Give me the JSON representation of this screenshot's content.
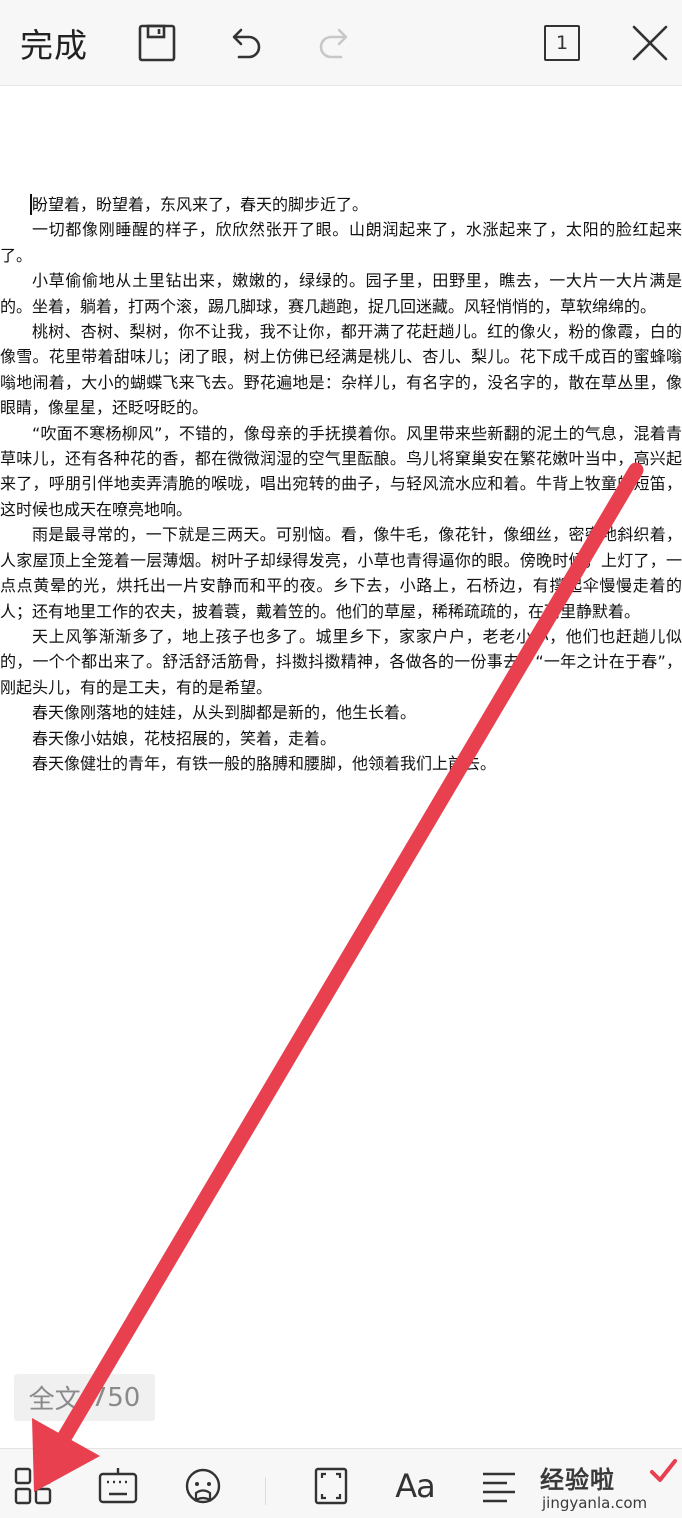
{
  "toolbar": {
    "done_label": "完成",
    "page_count": "1",
    "icons": [
      "save-icon",
      "undo-icon",
      "redo-icon",
      "page-count-icon",
      "close-icon"
    ]
  },
  "document": {
    "paragraphs": [
      "盼望着，盼望着，东风来了，春天的脚步近了。",
      "一切都像刚睡醒的样子，欣欣然张开了眼。山朗润起来了，水涨起来了，太阳的脸红起来了。",
      "小草偷偷地从土里钻出来，嫩嫩的，绿绿的。园子里，田野里，瞧去，一大片一大片满是的。坐着，躺着，打两个滚，踢几脚球，赛几趟跑，捉几回迷藏。风轻悄悄的，草软绵绵的。",
      "桃树、杏树、梨树，你不让我，我不让你，都开满了花赶趟儿。红的像火，粉的像霞，白的像雪。花里带着甜味儿；闭了眼，树上仿佛已经满是桃儿、杏儿、梨儿。花下成千成百的蜜蜂嗡嗡地闹着，大小的蝴蝶飞来飞去。野花遍地是：杂样儿，有名字的，没名字的，散在草丛里，像眼睛，像星星，还眨呀眨的。",
      "“吹面不寒杨柳风”，不错的，像母亲的手抚摸着你。风里带来些新翻的泥土的气息，混着青草味儿，还有各种花的香，都在微微润湿的空气里酝酿。鸟儿将窠巢安在繁花嫩叶当中，高兴起来了，呼朋引伴地卖弄清脆的喉咙，唱出宛转的曲子，与轻风流水应和着。牛背上牧童的短笛，这时候也成天在嘹亮地响。",
      "雨是最寻常的，一下就是三两天。可别恼。看，像牛毛，像花针，像细丝，密密地斜织着，人家屋顶上全笼着一层薄烟。树叶子却绿得发亮，小草也青得逼你的眼。傍晚时候，上灯了，一点点黄晕的光，烘托出一片安静而和平的夜。乡下去，小路上，石桥边，有撑起伞慢慢走着的人；还有地里工作的农夫，披着蓑，戴着笠的。他们的草屋，稀稀疏疏的，在雨里静默着。",
      "天上风筝渐渐多了，地上孩子也多了。城里乡下，家家户户，老老小小，他们也赶趟儿似的，一个个都出来了。舒活舒活筋骨，抖擞抖擞精神，各做各的一份事去。“一年之计在于春”，刚起头儿，有的是工夫，有的是希望。",
      "春天像刚落地的娃娃，从头到脚都是新的，他生长着。",
      "春天像小姑娘，花枝招展的，笑着，走着。",
      "春天像健壮的青年，有铁一般的胳膊和腰脚，他领着我们上前去。"
    ]
  },
  "status": {
    "word_count_label": "全文",
    "word_count": "750"
  },
  "bottom_toolbar": {
    "icons": [
      "apps-grid-icon",
      "keyboard-icon",
      "voice-assistant-icon",
      "fullscreen-icon",
      "font-style-icon",
      "align-icon"
    ],
    "font_label": "Aa"
  },
  "watermark": {
    "title": "经验啦",
    "url": "jingyanla.com"
  },
  "colors": {
    "toolbar_bg": "#f7f7f7",
    "arrow": "#e8404f",
    "text": "#111111"
  }
}
